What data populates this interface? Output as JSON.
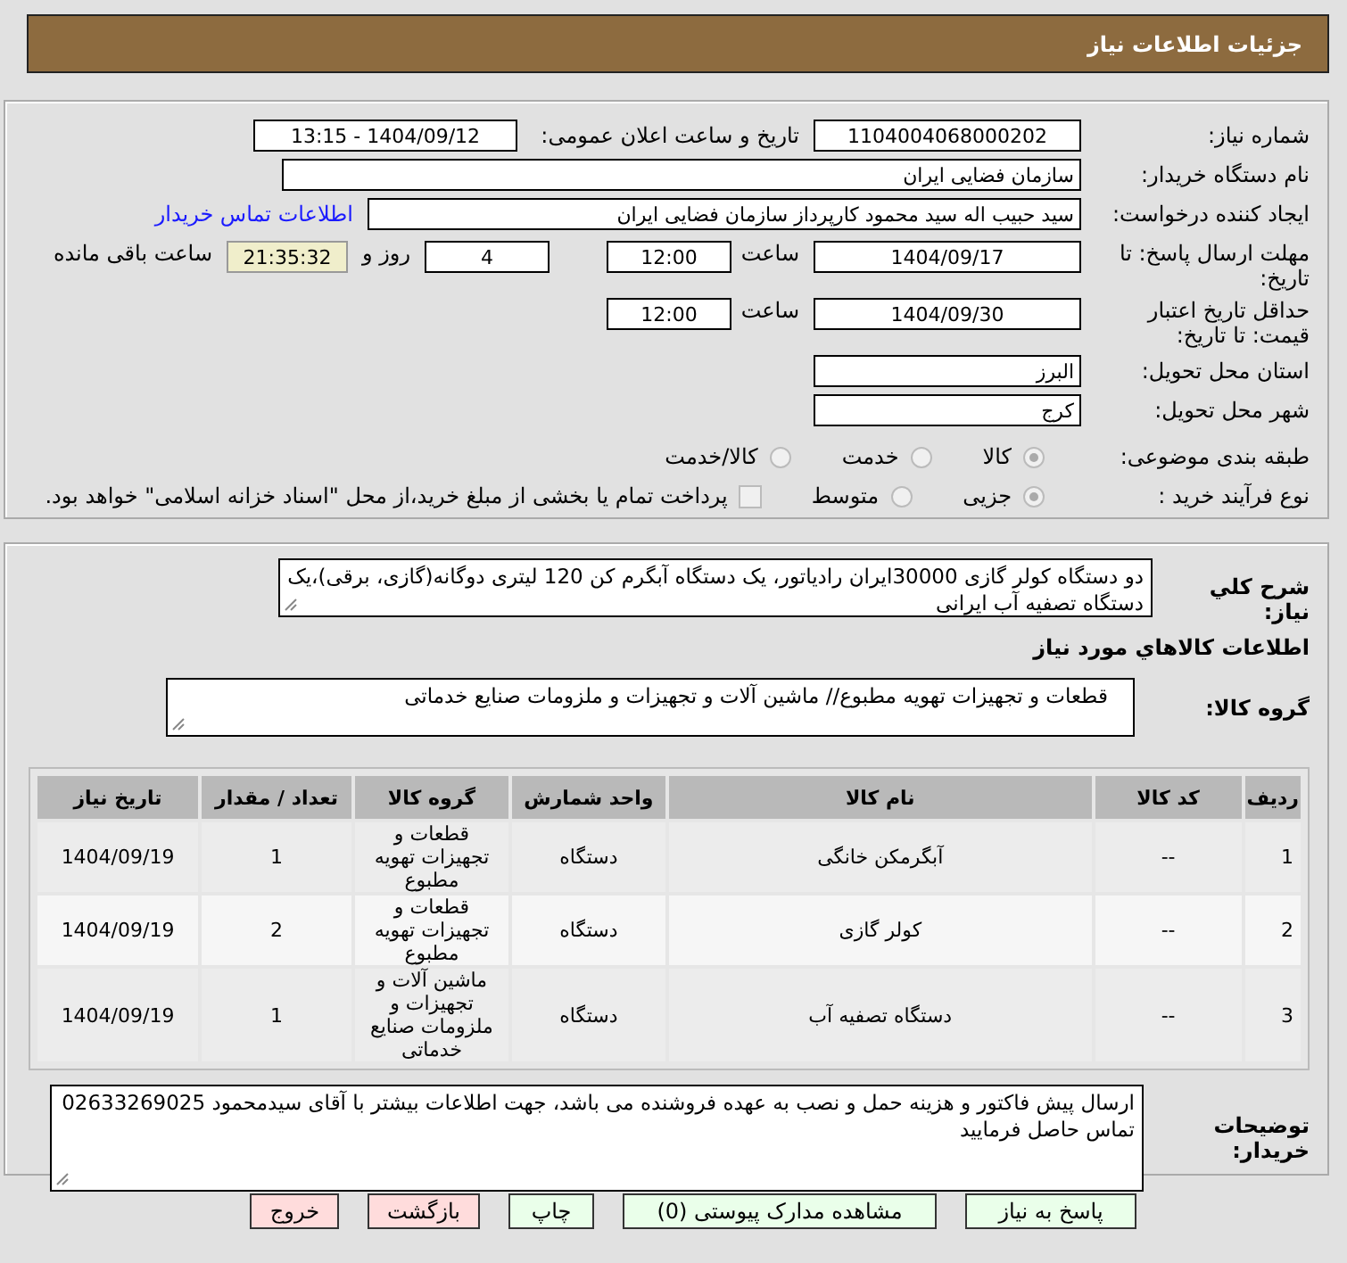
{
  "header": {
    "title": "جزئیات اطلاعات نیاز"
  },
  "need_number": {
    "label": "شماره نیاز:",
    "value": "1104004068000202"
  },
  "announce": {
    "label": "تاریخ و ساعت اعلان عمومی:",
    "value": "1404/09/12 - 13:15"
  },
  "buyer": {
    "label": "نام دستگاه خریدار:",
    "value": "سازمان فضایی ایران"
  },
  "creator": {
    "label": "ایجاد کننده درخواست:",
    "value": "سید حبیب اله سید محمود کارپرداز سازمان فضایی ایران",
    "link": "اطلاعات تماس خریدار"
  },
  "deadline": {
    "label": "مهلت ارسال پاسخ: تا تاریخ:",
    "date": "1404/09/17",
    "time_label": "ساعت",
    "time": "12:00",
    "days": "4",
    "days_label": "روز و",
    "remaining": "21:35:32",
    "remaining_label": "ساعت باقی مانده"
  },
  "validity": {
    "label": "حداقل تاریخ اعتبار قیمت: تا تاریخ:",
    "date": "1404/09/30",
    "time_label": "ساعت",
    "time": "12:00"
  },
  "province": {
    "label": "استان محل تحویل:",
    "value": "البرز"
  },
  "city": {
    "label": "شهر محل تحویل:",
    "value": "کرج"
  },
  "category": {
    "label": "طبقه بندی موضوعی:",
    "options": [
      {
        "label": "کالا",
        "selected": true
      },
      {
        "label": "خدمت",
        "selected": false
      },
      {
        "label": "کالا/خدمت",
        "selected": false
      }
    ]
  },
  "process": {
    "label": "نوع فرآیند خرید :",
    "options": [
      {
        "label": "جزیی",
        "selected": true
      },
      {
        "label": "متوسط",
        "selected": false
      }
    ],
    "payment": {
      "label": "پرداخت تمام یا بخشی از مبلغ خرید،از محل \"اسناد خزانه اسلامی\" خواهد بود.",
      "checked": false
    }
  },
  "description": {
    "label": "شرح کلي نیاز:",
    "value": "دو دستگاه کولر گازی 30000ایران رادیاتور، یک دستگاه آبگرم کن 120 لیتری دوگانه(گازی، برقی)،یک دستگاه تصفیه آب ایرانی"
  },
  "items_heading": "اطلاعات کالاهاي مورد نیاز",
  "goods_group": {
    "label": "گروه کالا:",
    "value": "قطعات و تجهیزات تهویه مطبوع// ماشین آلات و تجهیزات و ملزومات صنایع خدماتی"
  },
  "table": {
    "columns": [
      "ردیف",
      "کد کالا",
      "نام کالا",
      "واحد شمارش",
      "گروه کالا",
      "تعداد / مقدار",
      "تاریخ نیاز"
    ],
    "rows": [
      [
        "1",
        "--",
        "آبگرمکن خانگی",
        "دستگاه",
        "قطعات و تجهیزات تهویه مطبوع",
        "1",
        "1404/09/19"
      ],
      [
        "2",
        "--",
        "کولر گازی",
        "دستگاه",
        "قطعات و تجهیزات تهویه مطبوع",
        "2",
        "1404/09/19"
      ],
      [
        "3",
        "--",
        "دستگاه تصفیه آب",
        "دستگاه",
        "ماشین آلات و تجهیزات و ملزومات صنایع خدماتی",
        "1",
        "1404/09/19"
      ]
    ]
  },
  "buyer_notes": {
    "label": "توضیحات خریدار:",
    "value": "ارسال پیش فاکتور و هزینه حمل و نصب به عهده فروشنده می باشد، جهت اطلاعات بیشتر با آقای سیدمحمود 02633269025 تماس حاصل فرمایید"
  },
  "buttons": [
    {
      "label": "پاسخ به نیاز",
      "kind": "normal"
    },
    {
      "label": "مشاهده مدارک پیوستی (0)",
      "kind": "normal"
    },
    {
      "label": "چاپ",
      "kind": "normal"
    },
    {
      "label": "بازگشت",
      "kind": "danger"
    },
    {
      "label": "خروج",
      "kind": "danger"
    }
  ]
}
